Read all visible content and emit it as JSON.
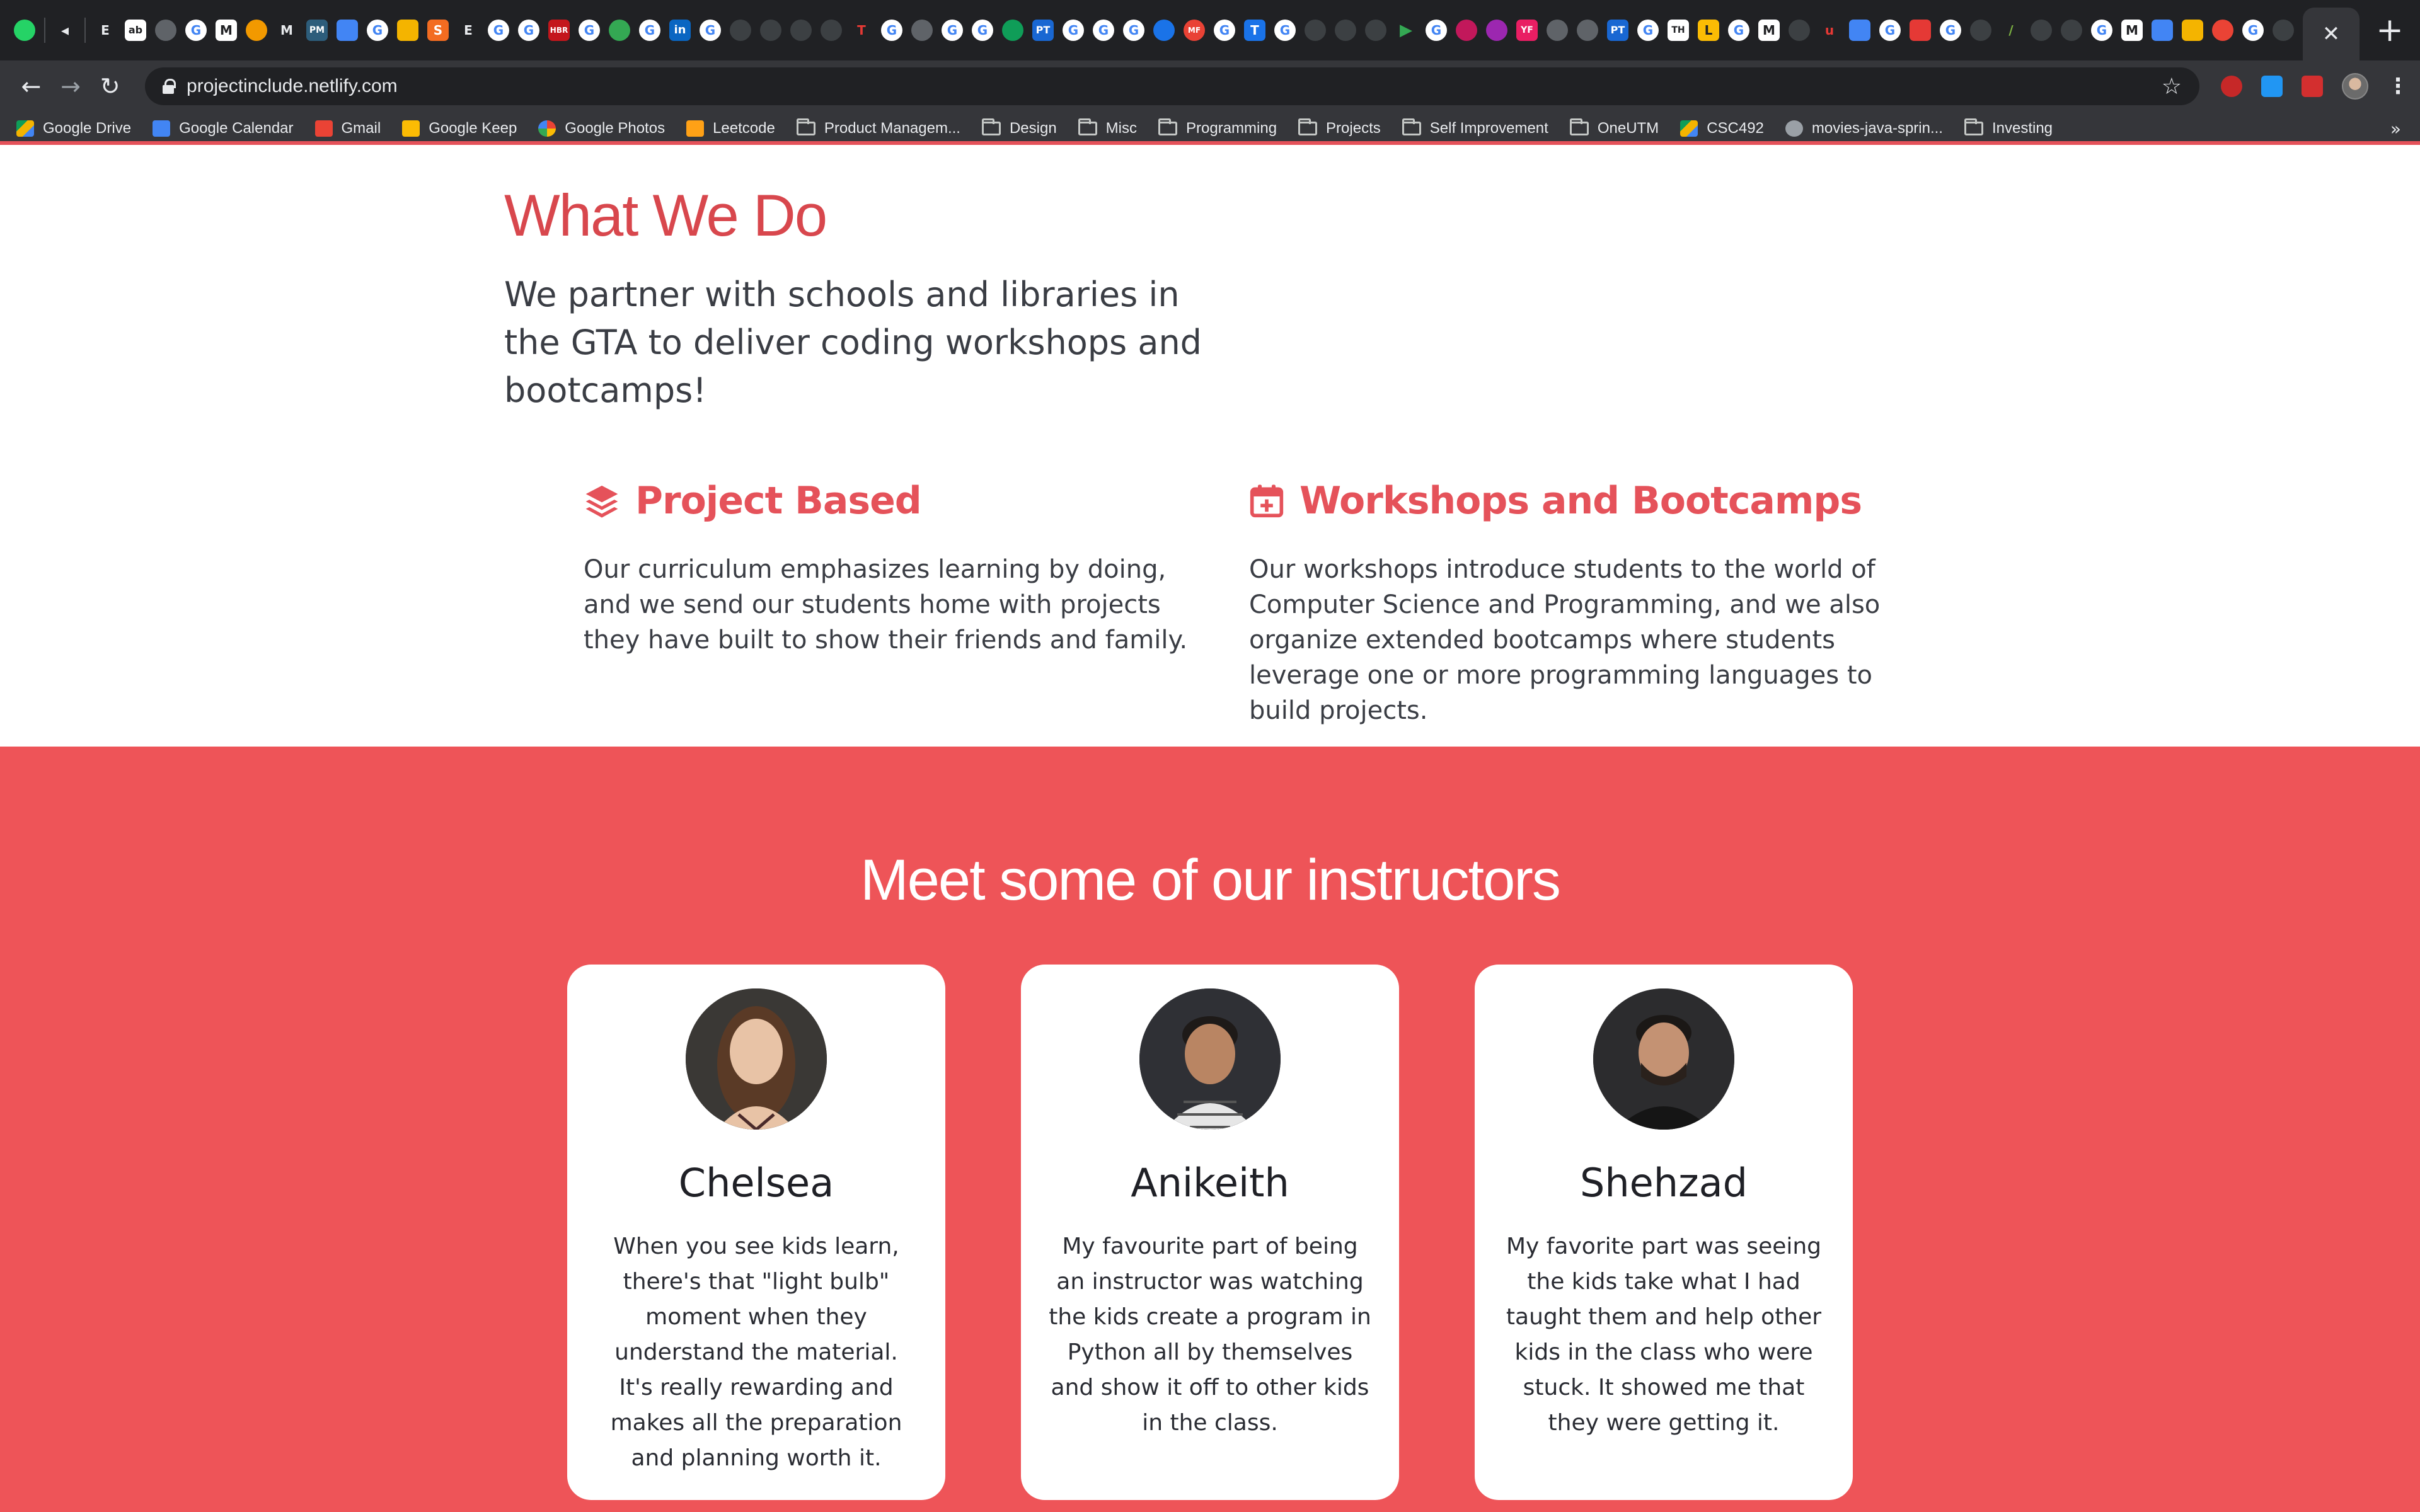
{
  "browser": {
    "url": "projectinclude.netlify.com",
    "bookmarks": [
      {
        "label": "Google Drive",
        "icon": "google-drive-icon"
      },
      {
        "label": "Google Calendar",
        "icon": "google-calendar-icon"
      },
      {
        "label": "Gmail",
        "icon": "gmail-icon"
      },
      {
        "label": "Google Keep",
        "icon": "google-keep-icon"
      },
      {
        "label": "Google Photos",
        "icon": "google-photos-icon"
      },
      {
        "label": "Leetcode",
        "icon": "leetcode-icon"
      },
      {
        "label": "Product Managem...",
        "icon": "folder-icon"
      },
      {
        "label": "Design",
        "icon": "folder-icon"
      },
      {
        "label": "Misc",
        "icon": "folder-icon"
      },
      {
        "label": "Programming",
        "icon": "folder-icon"
      },
      {
        "label": "Projects",
        "icon": "folder-icon"
      },
      {
        "label": "Self Improvement",
        "icon": "folder-icon"
      },
      {
        "label": "OneUTM",
        "icon": "folder-icon"
      },
      {
        "label": "CSC492",
        "icon": "google-drive-icon"
      },
      {
        "label": "movies-java-sprin...",
        "icon": "github-icon"
      },
      {
        "label": "Investing",
        "icon": "folder-icon"
      }
    ],
    "overflow_label": "»"
  },
  "what_we_do": {
    "title": "What We Do",
    "subtitle": "We partner with schools and libraries in the GTA to deliver coding workshops and bootcamps!",
    "features": [
      {
        "icon": "layers-icon",
        "title": "Project Based",
        "text": "Our curriculum emphasizes learning by doing, and we send our students home with projects they have built to show their friends and family."
      },
      {
        "icon": "calendar-plus-icon",
        "title": "Workshops and Bootcamps",
        "text": "Our workshops introduce students to the world of Computer Science and Programming, and we also organize extended bootcamps where students leverage one or more programming languages to build projects."
      }
    ]
  },
  "instructors": {
    "title": "Meet some of our instructors",
    "people": [
      {
        "name": "Chelsea",
        "quote": "When you see kids learn, there's that \"light bulb\" moment when they understand the material. It's really rewarding and makes all the preparation and planning worth it."
      },
      {
        "name": "Anikeith",
        "quote": "My favourite part of being an instructor was watching the kids create a program in Python all by themselves and show it off to other kids in the class."
      },
      {
        "name": "Shehzad",
        "quote": "My favorite part was seeing the kids take what I had taught them and help other kids in the class who were stuck. It showed me that they were getting it."
      }
    ]
  },
  "colors": {
    "accent": "#e5525a",
    "section_bg": "#ee5458",
    "heading": "#d8474d",
    "chrome_dark": "#202124",
    "chrome": "#35363a"
  }
}
